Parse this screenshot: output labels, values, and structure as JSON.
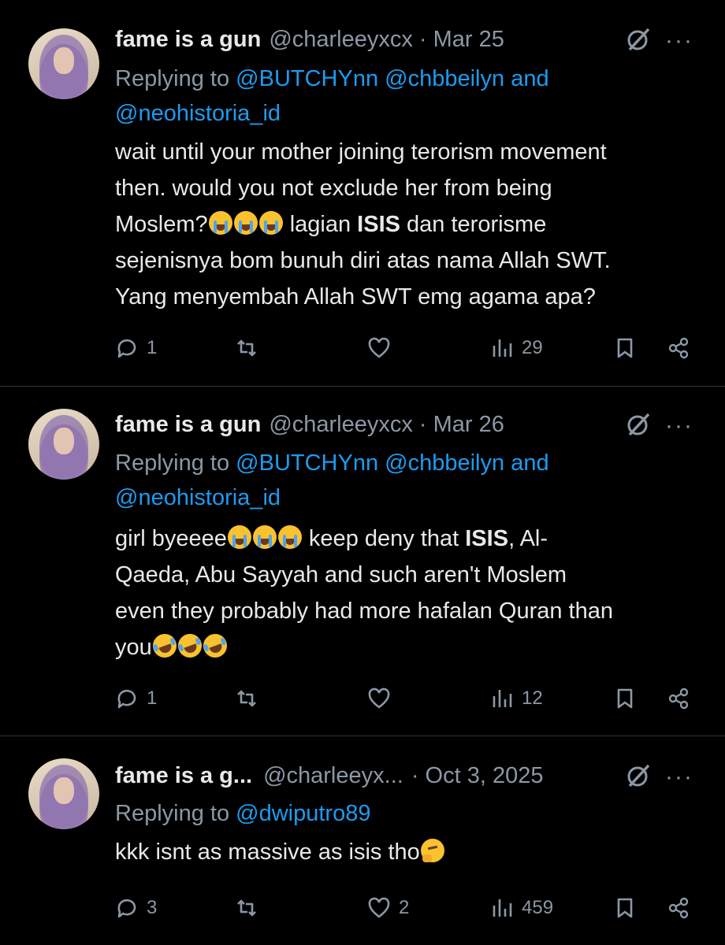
{
  "tweets": [
    {
      "name": "fame is a gun",
      "handle": "@charleeyxcx",
      "date": "· Mar 25",
      "replying_prefix": "Replying to",
      "mentions": [
        "@BUTCHYnn",
        "@chbbeilyn"
      ],
      "and_text": "and",
      "mention_last": "@neohistoria_id",
      "body_lines": {
        "l1": "wait until your mother joining terorism movement",
        "l2": "then. would you not exclude her from being",
        "l3a": "Moslem?",
        "l3b": " lagian ",
        "l3bold": "ISIS",
        "l3c": " dan terorisme",
        "l4": "sejenisnya bom bunuh diri atas nama Allah SWT.",
        "l5": "Yang menyembah Allah SWT emg agama apa?"
      },
      "replies": "1",
      "reposts": "",
      "likes": "",
      "views": "29"
    },
    {
      "name": "fame is a gun",
      "handle": "@charleeyxcx",
      "date": "· Mar 26",
      "replying_prefix": "Replying to",
      "mentions": [
        "@BUTCHYnn",
        "@chbbeilyn"
      ],
      "and_text": "and",
      "mention_last": "@neohistoria_id",
      "body_lines": {
        "l1a": "girl byeeee",
        "l1b": " keep deny that ",
        "l1bold": "ISIS",
        "l1c": ", Al-",
        "l2": "Qaeda, Abu Sayyah and such aren't Moslem",
        "l3": "even they probably had more hafalan Quran than",
        "l4": "you"
      },
      "replies": "1",
      "reposts": "",
      "likes": "",
      "views": "12"
    },
    {
      "name": "fame is a g...",
      "handle": "@charleeyx...",
      "date": "· Oct 3, 2025",
      "replying_prefix": "Replying to",
      "mention_last": "@dwiputro89",
      "body_lines": {
        "l1": "kkk isnt as massive as isis tho"
      },
      "replies": "3",
      "reposts": "",
      "likes": "2",
      "views": "459"
    }
  ],
  "more_label": "···",
  "colors": {
    "background": "#000000",
    "text": "#e7e9ea",
    "secondary": "#8b98a5",
    "link": "#1d9bf0",
    "divider": "#2f3336"
  },
  "icons": [
    "reply-icon",
    "repost-icon",
    "like-icon",
    "views-icon",
    "bookmark-icon",
    "share-icon",
    "grok-icon",
    "more-icon"
  ]
}
